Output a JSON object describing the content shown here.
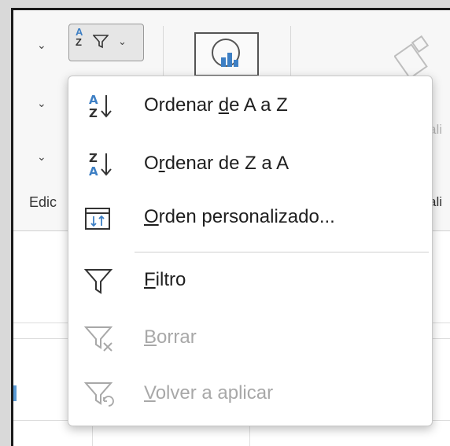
{
  "ribbon": {
    "group_label": "Edic",
    "right_fragment_faded": "ali",
    "right_fragment_group": "ali"
  },
  "sort_filter_button": {
    "az_top": "A",
    "az_bottom": "Z",
    "icon": "funnel-icon"
  },
  "menu": {
    "items": [
      {
        "id": "sort-a-z",
        "pre": "Ordenar ",
        "key": "d",
        "post": "e A a Z",
        "icon": "sort-ascending-icon",
        "top": "A",
        "bottom": "Z",
        "enabled": true
      },
      {
        "id": "sort-z-a",
        "pre": "O",
        "key": "r",
        "post": "denar de Z a A",
        "icon": "sort-descending-icon",
        "top": "Z",
        "bottom": "A",
        "enabled": true
      },
      {
        "id": "custom-sort",
        "pre": "",
        "key": "O",
        "post": "rden personalizado...",
        "icon": "custom-sort-icon",
        "enabled": true
      },
      {
        "id": "filter",
        "pre": "",
        "key": "F",
        "post": "iltro",
        "icon": "filter-icon",
        "enabled": true
      },
      {
        "id": "clear",
        "pre": "",
        "key": "B",
        "post": "orrar",
        "icon": "clear-filter-icon",
        "enabled": false
      },
      {
        "id": "reapply",
        "pre": "",
        "key": "V",
        "post": "olver a aplicar",
        "icon": "reapply-filter-icon",
        "enabled": false
      }
    ]
  },
  "colors": {
    "accent_blue": "#3d7fc4",
    "disabled_text": "#a8a8a8"
  }
}
